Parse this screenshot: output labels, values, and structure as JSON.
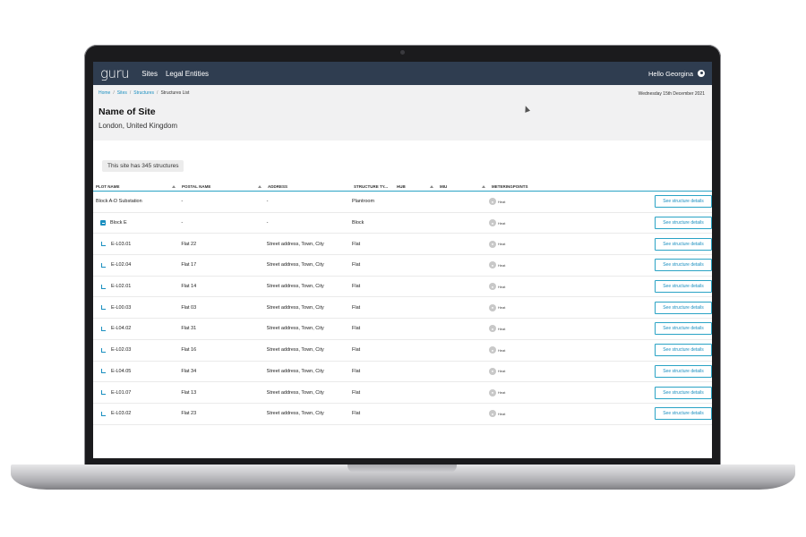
{
  "app": {
    "logo": "guru",
    "nav": [
      "Sites",
      "Legal Entities"
    ],
    "greeting": "Hello Georgina"
  },
  "breadcrumb": [
    "Home",
    "Sites",
    "Structures",
    "Structures List"
  ],
  "date": "Wednesday 15th December 2021",
  "site": {
    "title": "Name of Site",
    "location": "London, United Kingdom",
    "count_text": "This site has 345 structures"
  },
  "table": {
    "headers": [
      "PLOT NAME",
      "POSTAL NAME",
      "ADDRESS",
      "STRUCTURE TY...",
      "HUB",
      "MIU",
      "METERINGPOINTS"
    ],
    "button_label": "See structure details",
    "rows": [
      {
        "plot": "Block A-D Substation",
        "postal": "-",
        "address": "-",
        "type": "Plantroom",
        "meter": "Heat",
        "indent": "none"
      },
      {
        "plot": "Block E",
        "postal": "-",
        "address": "-",
        "type": "Block",
        "meter": "Heat",
        "indent": "parent"
      },
      {
        "plot": "E-L03.01",
        "postal": "Flat 22",
        "address": "Street address, Town, City",
        "type": "Flat",
        "meter": "Heat",
        "indent": "child"
      },
      {
        "plot": "E-L02.04",
        "postal": "Flat 17",
        "address": "Street address, Town, City",
        "type": "Flat",
        "meter": "Heat",
        "indent": "child"
      },
      {
        "plot": "E-L02.01",
        "postal": "Flat 14",
        "address": "Street address, Town, City",
        "type": "Flat",
        "meter": "Heat",
        "indent": "child"
      },
      {
        "plot": "E-L00.03",
        "postal": "Flat 03",
        "address": "Street address, Town, City",
        "type": "Flat",
        "meter": "Heat",
        "indent": "child"
      },
      {
        "plot": "E-L04.02",
        "postal": "Flat 31",
        "address": "Street address, Town, City",
        "type": "Flat",
        "meter": "Heat",
        "indent": "child"
      },
      {
        "plot": "E-L02.03",
        "postal": "Flat 16",
        "address": "Street address, Town, City",
        "type": "Flat",
        "meter": "Heat",
        "indent": "child"
      },
      {
        "plot": "E-L04.05",
        "postal": "Flat 34",
        "address": "Street address, Town, City",
        "type": "Flat",
        "meter": "Heat",
        "indent": "child"
      },
      {
        "plot": "E-L01.07",
        "postal": "Flat 13",
        "address": "Street address, Town, City",
        "type": "Flat",
        "meter": "Heat",
        "indent": "child"
      },
      {
        "plot": "E-L03.02",
        "postal": "Flat 23",
        "address": "Street address, Town, City",
        "type": "Flat",
        "meter": "Heat",
        "indent": "child"
      }
    ]
  },
  "colors": {
    "topbar": "#2f3d50",
    "accent": "#1a8fc0",
    "border_accent": "#2aa3c5"
  }
}
